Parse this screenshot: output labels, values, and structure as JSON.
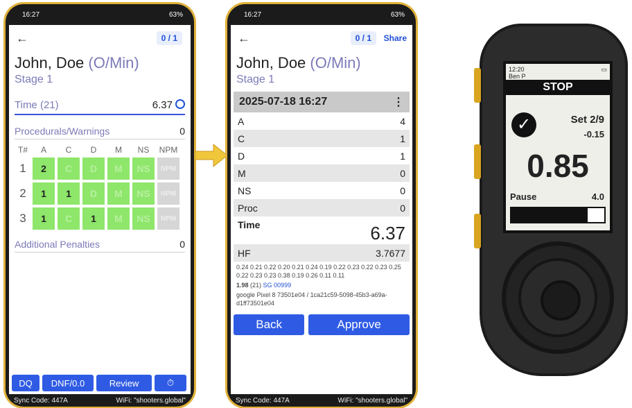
{
  "phone1": {
    "status": {
      "time": "16:27",
      "battery": "63%"
    },
    "counter": "0 / 1",
    "shooter": {
      "name": "John, Doe",
      "division": "(O/Min)"
    },
    "stage": "Stage 1",
    "time": {
      "label": "Time (21)",
      "value": "6.37"
    },
    "procedurals": {
      "label": "Procedurals/Warnings",
      "value": "0"
    },
    "grid": {
      "headers": [
        "T#",
        "A",
        "C",
        "D",
        "M",
        "NS",
        "NPM"
      ],
      "rows": [
        {
          "t": "1",
          "cells": [
            "2",
            "C",
            "D",
            "M",
            "NS",
            "NPM"
          ],
          "empty": [
            false,
            true,
            true,
            true,
            true,
            false
          ]
        },
        {
          "t": "2",
          "cells": [
            "1",
            "1",
            "D",
            "M",
            "NS",
            "NPM"
          ],
          "empty": [
            false,
            false,
            true,
            true,
            true,
            false
          ]
        },
        {
          "t": "3",
          "cells": [
            "1",
            "C",
            "1",
            "M",
            "NS",
            "NPM"
          ],
          "empty": [
            false,
            true,
            false,
            true,
            true,
            false
          ]
        }
      ]
    },
    "additional": {
      "label": "Additional Penalties",
      "value": "0"
    },
    "buttons": {
      "dq": "DQ",
      "dnf": "DNF/0.0",
      "review": "Review"
    },
    "footer": {
      "sync": "Sync Code: 447A",
      "wifi": "WiFi: \"shooters.global\""
    }
  },
  "phone2": {
    "status": {
      "time": "16:27",
      "battery": "63%"
    },
    "counter": "0 / 1",
    "share": "Share",
    "shooter": {
      "name": "John, Doe",
      "division": "(O/Min)"
    },
    "stage": "Stage 1",
    "datetime": "2025-07-18 16:27",
    "scores": [
      {
        "k": "A",
        "v": "4"
      },
      {
        "k": "C",
        "v": "1"
      },
      {
        "k": "D",
        "v": "1"
      },
      {
        "k": "M",
        "v": "0"
      },
      {
        "k": "NS",
        "v": "0"
      },
      {
        "k": "Proc",
        "v": "0"
      }
    ],
    "time": {
      "label": "Time",
      "value": "6.37"
    },
    "hf": {
      "label": "HF",
      "value": "3.7677"
    },
    "splits": "0.24 0.21 0.22 0.20 0.21 0.24 0.19 0.22 0.23 0.22 0.23 0.25 0.22 0.23 0.23 0.38 0.19 0.26 0.11 0.11",
    "summary_bold": "1.98",
    "summary_rest": " (21) ",
    "summary_link": "SG 00999",
    "device_info": "google Pixel 8 73501e04 / 1ca21c59-5098-45b3-a69a-d1ff73501e04",
    "buttons": {
      "back": "Back",
      "approve": "Approve"
    },
    "footer": {
      "sync": "Sync Code: 447A",
      "wifi": "WiFi: \"shooters.global\""
    }
  },
  "timer": {
    "clock": "12:20",
    "user": "Ben P",
    "stop_label": "STOP",
    "set": "Set 2/9",
    "split": "-0.15",
    "time": "0.85",
    "pause_label": "Pause",
    "pause_value": "4.0",
    "progress_fraction": 0.82
  }
}
